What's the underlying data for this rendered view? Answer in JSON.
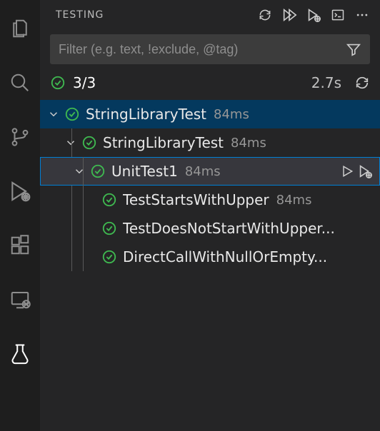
{
  "header": {
    "title": "TESTING"
  },
  "filter": {
    "placeholder": "Filter (e.g. text, !exclude, @tag)"
  },
  "summary": {
    "count": "3/3",
    "duration": "2.7s"
  },
  "tree": {
    "root": {
      "name": "StringLibraryTest",
      "time": "84ms",
      "child": {
        "name": "StringLibraryTest",
        "time": "84ms",
        "child": {
          "name": "UnitTest1",
          "time": "84ms",
          "tests": [
            {
              "name": "TestStartsWithUpper",
              "time": "84ms"
            },
            {
              "name": "TestDoesNotStartWithUpper...",
              "time": ""
            },
            {
              "name": "DirectCallWithNullOrEmpty...",
              "time": ""
            }
          ]
        }
      }
    }
  },
  "icons": {
    "pass": "pass-icon",
    "chevron_down": "chevron-down-icon",
    "refresh": "refresh-icon",
    "run_all": "run-all-icon",
    "debug_all": "debug-all-icon",
    "terminal": "terminal-icon",
    "more": "more-icon",
    "filter": "filter-icon",
    "run": "run-icon",
    "debug": "debug-icon"
  }
}
